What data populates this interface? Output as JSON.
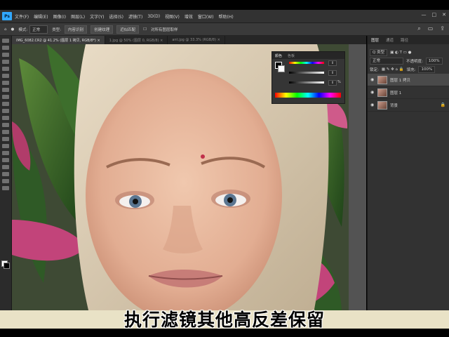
{
  "app": {
    "logo": "Ps"
  },
  "menubar": {
    "items": [
      "文件(F)",
      "编辑(E)",
      "图像(I)",
      "图层(L)",
      "文字(Y)",
      "选择(S)",
      "滤镜(T)",
      "3D(D)",
      "视图(V)",
      "增效",
      "窗口(W)",
      "帮助(H)"
    ],
    "window_controls": [
      "—",
      "□",
      "✕"
    ]
  },
  "optionsbar": {
    "mode_label": "模式:",
    "mode_value": "正常",
    "type_label": "类型:",
    "content_aware": "内容识别",
    "create_texture": "创建纹理",
    "proximity_match": "近似匹配",
    "sample_all_layers": "对所有图层取样"
  },
  "tabs": [
    {
      "label": "IMG_6082.CR2 @ 41.2% (图层 1 拷贝, RGB/8*) ×",
      "active": true
    },
    {
      "label": "1.jpg @ 50% (图层 0, RGB/8) ×",
      "active": false
    },
    {
      "label": "ant.jpg @ 33.3% (RGB/8) ×",
      "active": false
    }
  ],
  "color_panel": {
    "tabs": [
      "颜色",
      "色板"
    ],
    "fg_color": "#000000",
    "bg_color": "#ffffff",
    "sliders": [
      {
        "value": "0"
      },
      {
        "value": "0"
      },
      {
        "value": "0",
        "unit": "%"
      }
    ]
  },
  "layers_panel": {
    "tabs": [
      "图层",
      "通道",
      "路径"
    ],
    "filter_label": "Q 类型",
    "blend_mode": "正常",
    "opacity_label": "不透明度:",
    "opacity_value": "100%",
    "lock_label": "锁定:",
    "fill_label": "填充:",
    "fill_value": "100%",
    "layers": [
      {
        "name": "图层 1 拷贝",
        "selected": true,
        "locked": false
      },
      {
        "name": "图层 1",
        "selected": false,
        "locked": false
      },
      {
        "name": "背景",
        "selected": false,
        "locked": true
      }
    ]
  },
  "subtitle": "执行滤镜其他高反差保留"
}
